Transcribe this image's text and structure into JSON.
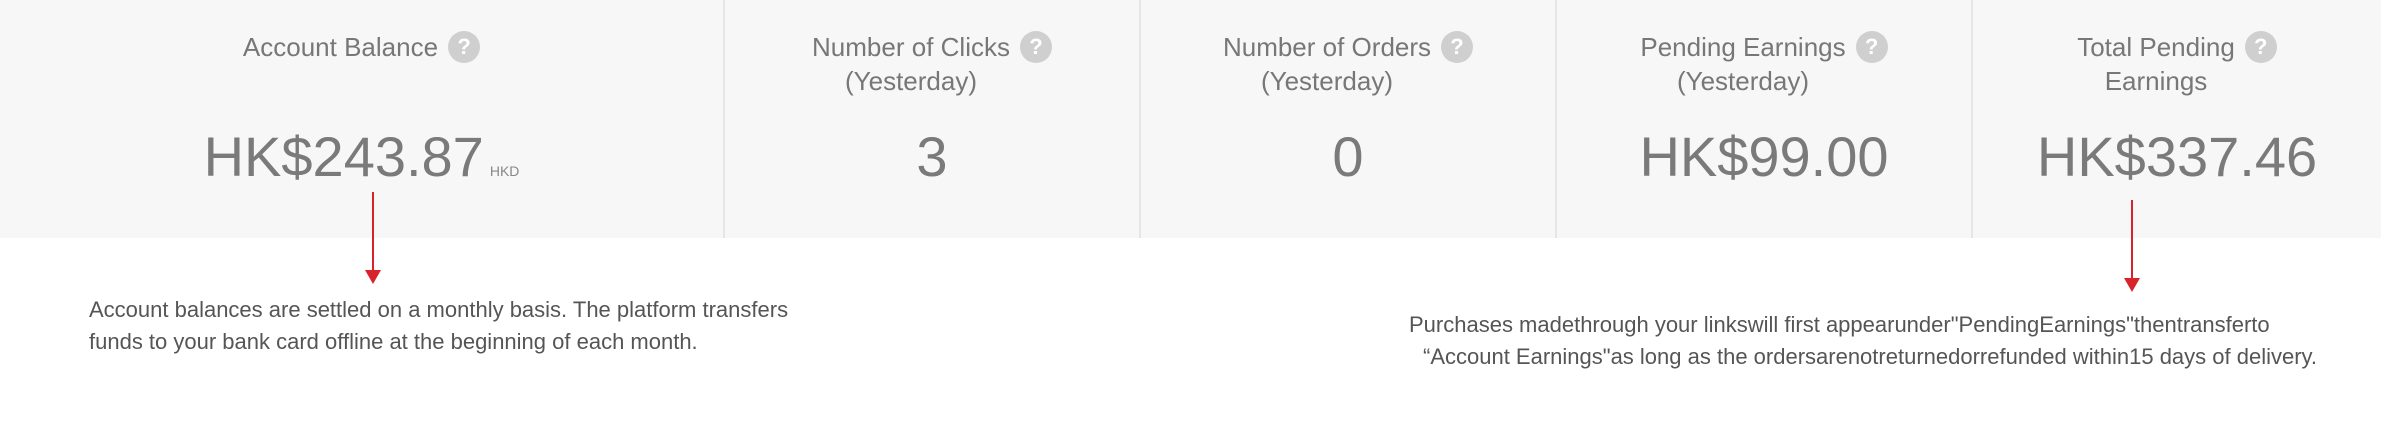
{
  "stats": [
    {
      "title_lines": [
        "Account Balance"
      ],
      "value": "HK$243.87",
      "unit": "HKD",
      "help": "?"
    },
    {
      "title_lines": [
        "Number of Clicks",
        "(Yesterday)"
      ],
      "value": "3",
      "unit": "",
      "help": "?"
    },
    {
      "title_lines": [
        "Number of Orders",
        "(Yesterday)"
      ],
      "value": "0",
      "unit": "",
      "help": "?"
    },
    {
      "title_lines": [
        "Pending Earnings",
        "(Yesterday)"
      ],
      "value": "HK$99.00",
      "unit": "",
      "help": "?"
    },
    {
      "title_lines": [
        "Total Pending",
        "Earnings"
      ],
      "value": "HK$337.46",
      "unit": "",
      "help": "?"
    }
  ],
  "notes": {
    "left": [
      "Account balances are settled on a monthly basis. The platform transfers",
      "funds to your bank card offline at the beginning of each month."
    ],
    "right": [
      "Purchases madethrough your linkswill first appearunder\"PendingEarnings\"thentransferto",
      "“Account Earnings\"as long as the ordersarenotreturnedorrefunded within15 days of delivery."
    ]
  },
  "colors": {
    "panel_background": "#f7f7f7",
    "divider": "#e6e6e6",
    "text": "#777777",
    "help_icon": "#cfcfcf",
    "arrow": "#d9232a"
  }
}
